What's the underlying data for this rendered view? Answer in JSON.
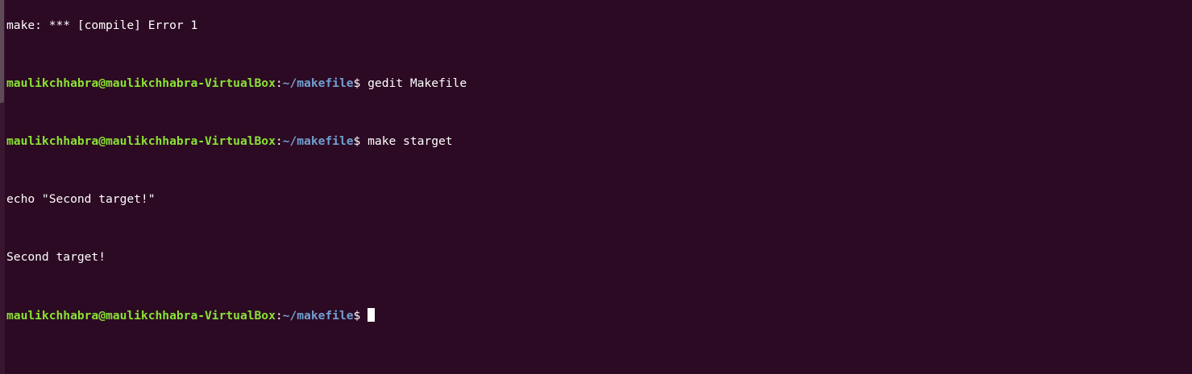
{
  "terminal": {
    "partial_top_line": "make: *** [compile] Error 1",
    "prompt": {
      "user_host": "maulikchhabra@maulikchhabra-VirtualBox",
      "colon": ":",
      "path": "~/makefile",
      "dollar": "$ "
    },
    "lines": [
      {
        "command": "gedit Makefile"
      },
      {
        "command": "make starget"
      },
      {
        "output": "echo \"Second target!\""
      },
      {
        "output": "Second target!"
      }
    ],
    "current_input": "",
    "colors": {
      "background": "#2c0a23",
      "user_host": "#8ae234",
      "path": "#729fcf",
      "text": "#ffffff"
    }
  }
}
